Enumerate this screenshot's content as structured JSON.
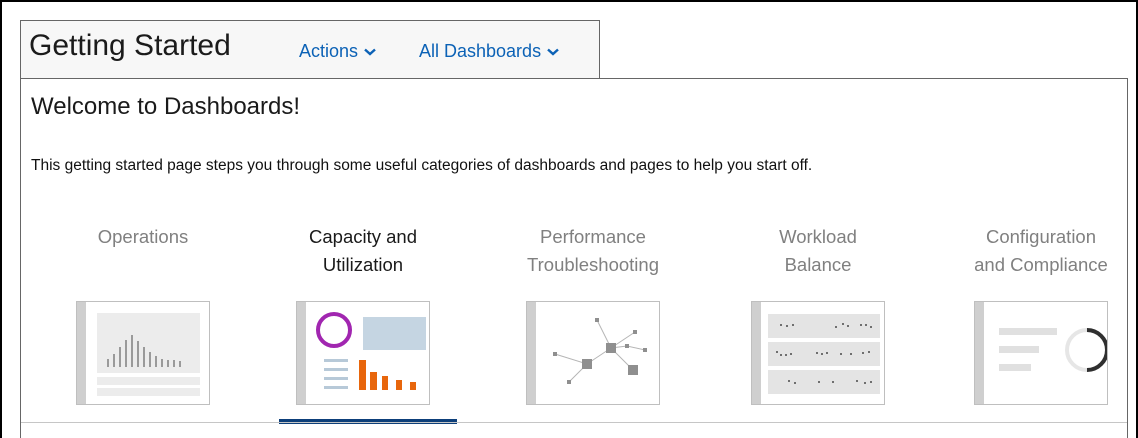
{
  "header": {
    "title": "Getting Started",
    "menus": [
      {
        "label": "Actions",
        "icon": "chevron-down-icon"
      },
      {
        "label": "All Dashboards",
        "icon": "chevron-down-icon"
      }
    ]
  },
  "main": {
    "heading": "Welcome to Dashboards!",
    "description": "This getting started page steps you through some useful categories of dashboards and pages to help you start off.",
    "categories": [
      {
        "line1": "Operations",
        "line2": "",
        "selected": false
      },
      {
        "line1": "Capacity and",
        "line2": "Utilization",
        "selected": true
      },
      {
        "line1": "Performance",
        "line2": "Troubleshooting",
        "selected": false
      },
      {
        "line1": "Workload",
        "line2": "Balance",
        "selected": false
      },
      {
        "line1": "Configuration",
        "line2": "and Compliance",
        "selected": false
      }
    ]
  },
  "colors": {
    "link": "#0c62b6",
    "selected_indicator": "#0d3f7a",
    "donut_magenta": "#a126b0",
    "bar_orange": "#e8660c",
    "placeholder_blue": "#c5d5e2",
    "muted_text": "#808080"
  }
}
